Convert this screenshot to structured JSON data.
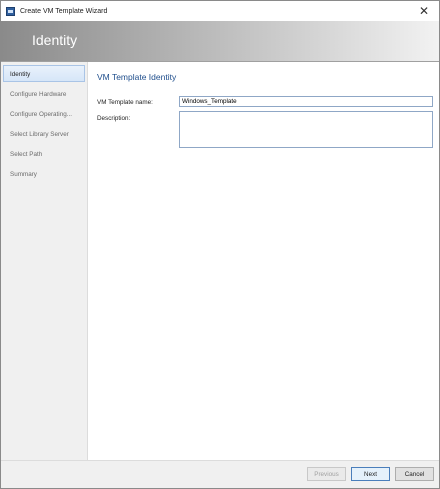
{
  "window": {
    "title": "Create VM Template Wizard",
    "close_glyph": "✕"
  },
  "banner": {
    "title": "Identity"
  },
  "sidebar": {
    "items": [
      {
        "label": "Identity",
        "active": true
      },
      {
        "label": "Configure Hardware",
        "active": false
      },
      {
        "label": "Configure Operating...",
        "active": false
      },
      {
        "label": "Select Library Server",
        "active": false
      },
      {
        "label": "Select Path",
        "active": false
      },
      {
        "label": "Summary",
        "active": false
      }
    ]
  },
  "main": {
    "section_title": "VM Template Identity",
    "name_label": "VM Template name:",
    "name_value": "Windows_Template",
    "description_label": "Description:",
    "description_value": ""
  },
  "footer": {
    "previous_label": "Previous",
    "next_label": "Next",
    "cancel_label": "Cancel"
  },
  "colors": {
    "accent": "#1f4e8c",
    "active_nav": "#d6e6f8"
  }
}
